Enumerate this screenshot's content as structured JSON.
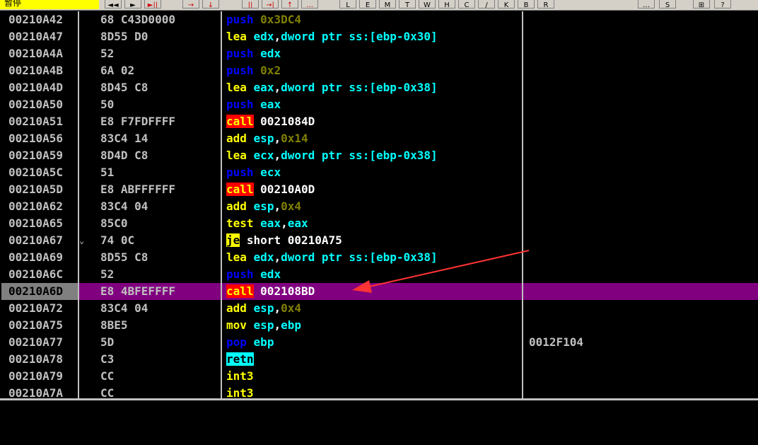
{
  "toolbar": {
    "label": "暂停",
    "buttons": [
      "◄◄",
      "►",
      "►||",
      "→",
      "↓",
      "||",
      "→|",
      "↑",
      "…",
      "L",
      "E",
      "M",
      "T",
      "W",
      "H",
      "C",
      "/",
      "K",
      "B",
      "R",
      "…",
      "S",
      "⊞",
      "?"
    ]
  },
  "colors": {
    "background": "#000000",
    "selected_row": "#800080",
    "call_bg": "#ff0000",
    "push_text": "#0000ff",
    "register_text": "#00ffff",
    "immediate_text": "#808000",
    "arrow": "#ff3333"
  },
  "rows": [
    {
      "addr": "00210A42",
      "jmp": "",
      "hex": "68 C43D0000",
      "mn": "push",
      "mnClass": "mn-push",
      "ops": [
        {
          "t": "0x3DC4",
          "c": "op-num"
        }
      ],
      "comment": ""
    },
    {
      "addr": "00210A47",
      "jmp": "",
      "hex": "8D55 D0",
      "mn": "lea",
      "mnClass": "mn-normal",
      "ops": [
        {
          "t": "edx",
          "c": "op-reg"
        },
        {
          "t": ",",
          "c": "op-norm"
        },
        {
          "t": "dword ptr ss:[ebp-0x30]",
          "c": "op-reg"
        }
      ],
      "comment": ""
    },
    {
      "addr": "00210A4A",
      "jmp": "",
      "hex": "52",
      "mn": "push",
      "mnClass": "mn-push",
      "ops": [
        {
          "t": "edx",
          "c": "op-reg"
        }
      ],
      "comment": ""
    },
    {
      "addr": "00210A4B",
      "jmp": "",
      "hex": "6A 02",
      "mn": "push",
      "mnClass": "mn-push",
      "ops": [
        {
          "t": "0x2",
          "c": "op-num"
        }
      ],
      "comment": ""
    },
    {
      "addr": "00210A4D",
      "jmp": "",
      "hex": "8D45 C8",
      "mn": "lea",
      "mnClass": "mn-normal",
      "ops": [
        {
          "t": "eax",
          "c": "op-reg"
        },
        {
          "t": ",",
          "c": "op-norm"
        },
        {
          "t": "dword ptr ss:[ebp-0x38]",
          "c": "op-reg"
        }
      ],
      "comment": ""
    },
    {
      "addr": "00210A50",
      "jmp": "",
      "hex": "50",
      "mn": "push",
      "mnClass": "mn-push",
      "ops": [
        {
          "t": "eax",
          "c": "op-reg"
        }
      ],
      "comment": ""
    },
    {
      "addr": "00210A51",
      "jmp": "",
      "hex": "E8 F7FDFFFF",
      "mn": "call",
      "mnClass": "mn-call",
      "ops": [
        {
          "t": "0021084D",
          "c": "op-norm"
        }
      ],
      "comment": ""
    },
    {
      "addr": "00210A56",
      "jmp": "",
      "hex": "83C4 14",
      "mn": "add",
      "mnClass": "mn-normal",
      "ops": [
        {
          "t": "esp",
          "c": "op-reg"
        },
        {
          "t": ",",
          "c": "op-norm"
        },
        {
          "t": "0x14",
          "c": "op-num"
        }
      ],
      "comment": ""
    },
    {
      "addr": "00210A59",
      "jmp": "",
      "hex": "8D4D C8",
      "mn": "lea",
      "mnClass": "mn-normal",
      "ops": [
        {
          "t": "ecx",
          "c": "op-reg"
        },
        {
          "t": ",",
          "c": "op-norm"
        },
        {
          "t": "dword ptr ss:[ebp-0x38]",
          "c": "op-reg"
        }
      ],
      "comment": ""
    },
    {
      "addr": "00210A5C",
      "jmp": "",
      "hex": "51",
      "mn": "push",
      "mnClass": "mn-push",
      "ops": [
        {
          "t": "ecx",
          "c": "op-reg"
        }
      ],
      "comment": ""
    },
    {
      "addr": "00210A5D",
      "jmp": "",
      "hex": "E8 ABFFFFFF",
      "mn": "call",
      "mnClass": "mn-call",
      "ops": [
        {
          "t": "00210A0D",
          "c": "op-norm"
        }
      ],
      "comment": ""
    },
    {
      "addr": "00210A62",
      "jmp": "",
      "hex": "83C4 04",
      "mn": "add",
      "mnClass": "mn-normal",
      "ops": [
        {
          "t": "esp",
          "c": "op-reg"
        },
        {
          "t": ",",
          "c": "op-norm"
        },
        {
          "t": "0x4",
          "c": "op-num"
        }
      ],
      "comment": ""
    },
    {
      "addr": "00210A65",
      "jmp": "",
      "hex": "85C0",
      "mn": "test",
      "mnClass": "mn-normal",
      "ops": [
        {
          "t": "eax",
          "c": "op-reg"
        },
        {
          "t": ",",
          "c": "op-norm"
        },
        {
          "t": "eax",
          "c": "op-reg"
        }
      ],
      "comment": ""
    },
    {
      "addr": "00210A67",
      "jmp": "⌄",
      "hex": "74 0C",
      "mn": "je",
      "mnClass": "mn-je",
      "ops": [
        {
          "t": "short 00210A75",
          "c": "op-norm"
        }
      ],
      "comment": ""
    },
    {
      "addr": "00210A69",
      "jmp": "",
      "hex": "8D55 C8",
      "mn": "lea",
      "mnClass": "mn-normal",
      "ops": [
        {
          "t": "edx",
          "c": "op-reg"
        },
        {
          "t": ",",
          "c": "op-norm"
        },
        {
          "t": "dword ptr ss:[ebp-0x38]",
          "c": "op-reg"
        }
      ],
      "comment": ""
    },
    {
      "addr": "00210A6C",
      "jmp": "",
      "hex": "52",
      "mn": "push",
      "mnClass": "mn-push",
      "ops": [
        {
          "t": "edx",
          "c": "op-reg"
        }
      ],
      "comment": ""
    },
    {
      "addr": "00210A6D",
      "jmp": "",
      "hex": "E8 4BFEFFFF",
      "mn": "call",
      "mnClass": "mn-call",
      "ops": [
        {
          "t": "002108BD",
          "c": "op-norm"
        }
      ],
      "comment": "",
      "selected": true
    },
    {
      "addr": "00210A72",
      "jmp": "",
      "hex": "83C4 04",
      "mn": "add",
      "mnClass": "mn-normal",
      "ops": [
        {
          "t": "esp",
          "c": "op-reg"
        },
        {
          "t": ",",
          "c": "op-norm"
        },
        {
          "t": "0x4",
          "c": "op-num"
        }
      ],
      "comment": ""
    },
    {
      "addr": "00210A75",
      "jmp": "",
      "hex": "8BE5",
      "mn": "mov",
      "mnClass": "mn-normal",
      "ops": [
        {
          "t": "esp",
          "c": "op-reg"
        },
        {
          "t": ",",
          "c": "op-norm"
        },
        {
          "t": "ebp",
          "c": "op-reg"
        }
      ],
      "comment": ""
    },
    {
      "addr": "00210A77",
      "jmp": "",
      "hex": "5D",
      "mn": "pop",
      "mnClass": "mn-push",
      "ops": [
        {
          "t": "ebp",
          "c": "op-reg"
        }
      ],
      "comment": "0012F104"
    },
    {
      "addr": "00210A78",
      "jmp": "",
      "hex": "C3",
      "mn": "retn",
      "mnClass": "mn-retn",
      "ops": [],
      "comment": ""
    },
    {
      "addr": "00210A79",
      "jmp": "",
      "hex": "CC",
      "mn": "int3",
      "mnClass": "mn-normal",
      "ops": [],
      "comment": ""
    },
    {
      "addr": "00210A7A",
      "jmp": "",
      "hex": "CC",
      "mn": "int3",
      "mnClass": "mn-normal",
      "ops": [],
      "comment": ""
    }
  ]
}
